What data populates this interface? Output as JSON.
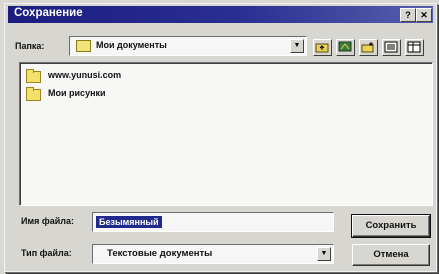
{
  "window": {
    "title": "Сохранение",
    "help_button": "?",
    "close_button": "✕"
  },
  "folder_bar": {
    "label": "Папка:",
    "current_folder": "Мои документы",
    "dropdown_icon": "chevron-down-icon",
    "tools": [
      {
        "name": "up-folder-icon"
      },
      {
        "name": "desktop-icon"
      },
      {
        "name": "new-folder-icon"
      },
      {
        "name": "list-view-icon"
      },
      {
        "name": "details-view-icon"
      }
    ]
  },
  "file_list": {
    "items": [
      {
        "label": "www.yunusi.com",
        "icon": "folder-icon"
      },
      {
        "label": "Мои рисунки",
        "icon": "folder-icon"
      }
    ]
  },
  "filename": {
    "label": "Имя файла:",
    "value": "Безымянный"
  },
  "filetype": {
    "label": "Тип файла:",
    "value": "Текстовые документы"
  },
  "buttons": {
    "save": "Сохранить",
    "cancel": "Отмена"
  },
  "colors": {
    "titlebar": "#1b1d7e",
    "selection": "#1f2a8c",
    "folder": "#f3e06b",
    "face": "#d8d6d0"
  }
}
